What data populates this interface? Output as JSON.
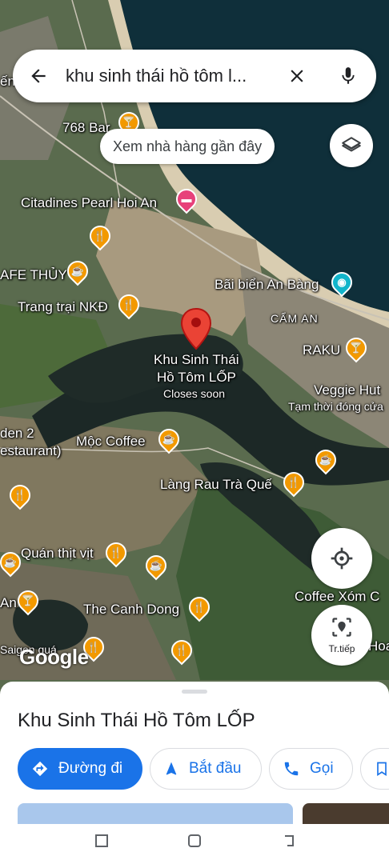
{
  "status_bar": {
    "left_text": "",
    "right_text": ""
  },
  "search": {
    "query": "khu sinh thái hồ tôm l..."
  },
  "chip": {
    "label": "Xem nhà hàng gần đây"
  },
  "map_labels": {
    "bar768": "768 Bar",
    "citadines": "Citadines Pearl Hoi An",
    "cafe_thuy": "AFE THỦY",
    "trang_trai": "Trang trại NKĐ",
    "bai_bien": "Bãi biển An Bàng",
    "cam_an": "CẨM AN",
    "raku": "RAKU",
    "selected_name_1": "Khu Sinh Thái",
    "selected_name_2": "Hồ Tôm LỐP",
    "selected_status": "Closes soon",
    "veggie": "Veggie Hut",
    "veggie_status": "Tạm thời đóng cửa",
    "den2": "den 2",
    "restaurant": "estaurant)",
    "moc_coffee": "Mộc Coffee",
    "lang_rau": "Làng Rau Trà Quế",
    "quan_thit_vit": "Quán thịt vịt",
    "an": "An",
    "canh_dong": "The Canh Dong",
    "coffee_xom": "Coffee Xóm C",
    "saigon": "Saigon quá",
    "hoa": "Hoa",
    "en": "ến",
    "google": "Google"
  },
  "next_button": {
    "label": "Tr.tiếp"
  },
  "place": {
    "title": "Khu Sinh Thái Hồ Tôm LỐP",
    "actions": [
      "Đường đi",
      "Bắt đầu",
      "Gọi"
    ]
  },
  "colors": {
    "accent": "#1a73e8",
    "pin_red": "#ea4335",
    "food": "#f29900",
    "hotel": "#e7417a",
    "beach": "#12b5cb"
  },
  "icons": [
    "back-arrow-icon",
    "close-icon",
    "mic-icon",
    "layers-icon",
    "my-location-icon",
    "directions-icon",
    "navigation-icon",
    "phone-icon",
    "bookmark-icon"
  ]
}
